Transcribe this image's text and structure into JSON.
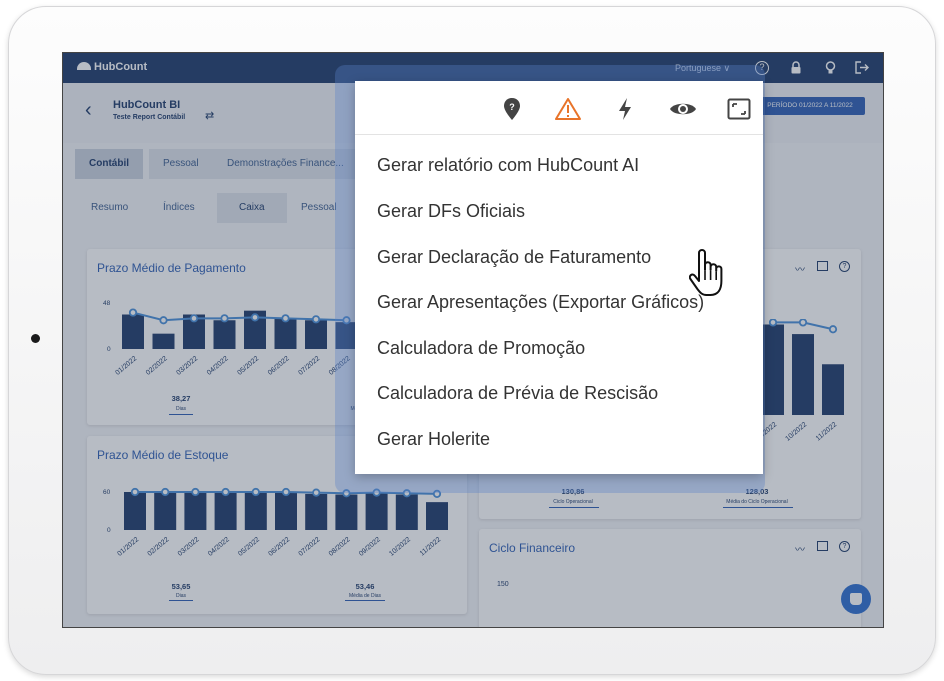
{
  "app": {
    "logo_text": "HubCount",
    "language": "Portuguese ∨"
  },
  "header": {
    "title": "HubCount BI",
    "subtitle": "Teste Report Contábil",
    "period": "PERÍODO 01/2022 A 11/2022"
  },
  "tabs_primary": [
    "Contábil",
    "Pessoal",
    "Demonstrações Finance..."
  ],
  "tabs_secondary": [
    "Resumo",
    "Índices",
    "Caixa",
    "Pessoal"
  ],
  "menu": {
    "items": [
      "Gerar relatório com HubCount AI",
      "Gerar DFs Oficiais",
      "Gerar Declaração de Faturamento",
      "Gerar Apresentações (Exportar Gráficos)",
      "Calculadora de Promoção",
      "Calculadora de Prévia de Rescisão",
      "Gerar Holerite"
    ],
    "icons": [
      "map-marker-question-icon",
      "warning-icon",
      "lightning-icon",
      "eye-icon",
      "fullscreen-icon"
    ]
  },
  "cards": {
    "pagamento": {
      "title": "Prazo Médio de Pagamento",
      "stat1_value": "38,27",
      "stat1_label": "Dias",
      "stat2_label": "Mé"
    },
    "estoque": {
      "title": "Prazo Médio de Estoque",
      "stat1_value": "53,65",
      "stat1_label": "Dias",
      "stat2_value": "53,46",
      "stat2_label": "Média de Dias"
    },
    "ciclo_op": {
      "stat1_value": "130,86",
      "stat1_label": "Ciclo Operacional",
      "stat2_value": "128,03",
      "stat2_label": "Média do Ciclo Operacional"
    },
    "financeiro": {
      "title": "Ciclo Financeiro",
      "axis_top": "150"
    }
  },
  "chart_data": [
    {
      "type": "bar",
      "title": "Prazo Médio de Pagamento",
      "categories": [
        "01/2022",
        "02/2022",
        "03/2022",
        "04/2022",
        "05/2022",
        "06/2022",
        "07/2022",
        "08/2022"
      ],
      "values": [
        36,
        16,
        36,
        30,
        40,
        32,
        30,
        28
      ],
      "average_line": [
        38,
        30,
        32,
        32,
        33,
        32,
        31,
        30
      ],
      "yticks": [
        "48",
        "0"
      ]
    },
    {
      "type": "bar",
      "title": "Prazo Médio de Estoque",
      "categories": [
        "01/2022",
        "02/2022",
        "03/2022",
        "04/2022",
        "05/2022",
        "06/2022",
        "07/2022",
        "08/2022",
        "09/2022",
        "10/2022",
        "11/2022"
      ],
      "values": [
        60,
        60,
        60,
        60,
        60,
        60,
        57,
        56,
        58,
        56,
        44
      ],
      "average_line": [
        60,
        60,
        60,
        60,
        60,
        60,
        59,
        58,
        59,
        58,
        57
      ],
      "yticks": [
        "60",
        "0"
      ]
    },
    {
      "type": "bar",
      "categories": [
        "09/2022",
        "10/2022",
        "11/2022"
      ],
      "values": [
        132,
        118,
        74
      ],
      "average_line": [
        135,
        135,
        125
      ]
    }
  ]
}
